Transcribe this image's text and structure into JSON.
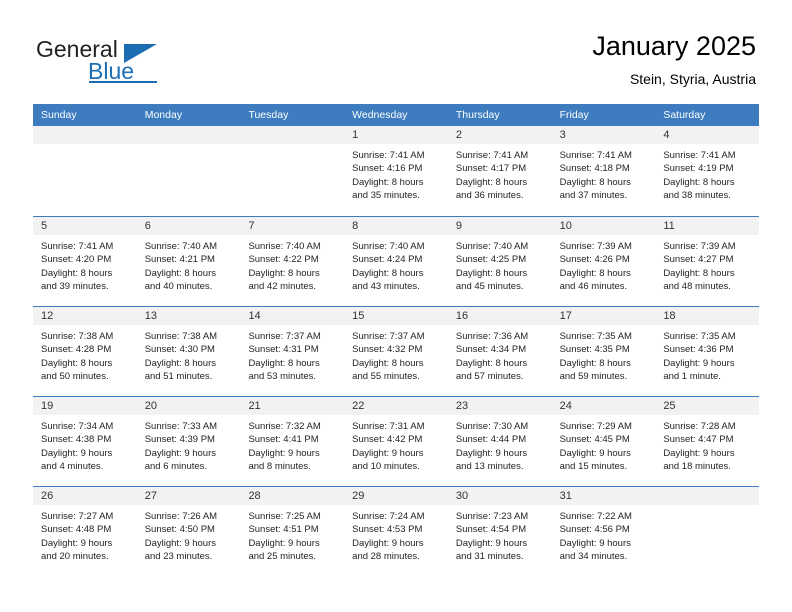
{
  "brand": {
    "name_part1": "General",
    "name_part2": "Blue",
    "logo_icon": "triangle-play-icon",
    "accent_color": "#1b6cb0"
  },
  "header": {
    "title": "January 2025",
    "subtitle": "Stein, Styria, Austria"
  },
  "calendar": {
    "header_bg": "#3d7cbf",
    "daynum_bg": "#f2f2f2",
    "weekdays": [
      "Sunday",
      "Monday",
      "Tuesday",
      "Wednesday",
      "Thursday",
      "Friday",
      "Saturday"
    ],
    "weeks": [
      [
        {
          "day": "",
          "lines": []
        },
        {
          "day": "",
          "lines": []
        },
        {
          "day": "",
          "lines": []
        },
        {
          "day": "1",
          "lines": [
            "Sunrise: 7:41 AM",
            "Sunset: 4:16 PM",
            "Daylight: 8 hours",
            "and 35 minutes."
          ]
        },
        {
          "day": "2",
          "lines": [
            "Sunrise: 7:41 AM",
            "Sunset: 4:17 PM",
            "Daylight: 8 hours",
            "and 36 minutes."
          ]
        },
        {
          "day": "3",
          "lines": [
            "Sunrise: 7:41 AM",
            "Sunset: 4:18 PM",
            "Daylight: 8 hours",
            "and 37 minutes."
          ]
        },
        {
          "day": "4",
          "lines": [
            "Sunrise: 7:41 AM",
            "Sunset: 4:19 PM",
            "Daylight: 8 hours",
            "and 38 minutes."
          ]
        }
      ],
      [
        {
          "day": "5",
          "lines": [
            "Sunrise: 7:41 AM",
            "Sunset: 4:20 PM",
            "Daylight: 8 hours",
            "and 39 minutes."
          ]
        },
        {
          "day": "6",
          "lines": [
            "Sunrise: 7:40 AM",
            "Sunset: 4:21 PM",
            "Daylight: 8 hours",
            "and 40 minutes."
          ]
        },
        {
          "day": "7",
          "lines": [
            "Sunrise: 7:40 AM",
            "Sunset: 4:22 PM",
            "Daylight: 8 hours",
            "and 42 minutes."
          ]
        },
        {
          "day": "8",
          "lines": [
            "Sunrise: 7:40 AM",
            "Sunset: 4:24 PM",
            "Daylight: 8 hours",
            "and 43 minutes."
          ]
        },
        {
          "day": "9",
          "lines": [
            "Sunrise: 7:40 AM",
            "Sunset: 4:25 PM",
            "Daylight: 8 hours",
            "and 45 minutes."
          ]
        },
        {
          "day": "10",
          "lines": [
            "Sunrise: 7:39 AM",
            "Sunset: 4:26 PM",
            "Daylight: 8 hours",
            "and 46 minutes."
          ]
        },
        {
          "day": "11",
          "lines": [
            "Sunrise: 7:39 AM",
            "Sunset: 4:27 PM",
            "Daylight: 8 hours",
            "and 48 minutes."
          ]
        }
      ],
      [
        {
          "day": "12",
          "lines": [
            "Sunrise: 7:38 AM",
            "Sunset: 4:28 PM",
            "Daylight: 8 hours",
            "and 50 minutes."
          ]
        },
        {
          "day": "13",
          "lines": [
            "Sunrise: 7:38 AM",
            "Sunset: 4:30 PM",
            "Daylight: 8 hours",
            "and 51 minutes."
          ]
        },
        {
          "day": "14",
          "lines": [
            "Sunrise: 7:37 AM",
            "Sunset: 4:31 PM",
            "Daylight: 8 hours",
            "and 53 minutes."
          ]
        },
        {
          "day": "15",
          "lines": [
            "Sunrise: 7:37 AM",
            "Sunset: 4:32 PM",
            "Daylight: 8 hours",
            "and 55 minutes."
          ]
        },
        {
          "day": "16",
          "lines": [
            "Sunrise: 7:36 AM",
            "Sunset: 4:34 PM",
            "Daylight: 8 hours",
            "and 57 minutes."
          ]
        },
        {
          "day": "17",
          "lines": [
            "Sunrise: 7:35 AM",
            "Sunset: 4:35 PM",
            "Daylight: 8 hours",
            "and 59 minutes."
          ]
        },
        {
          "day": "18",
          "lines": [
            "Sunrise: 7:35 AM",
            "Sunset: 4:36 PM",
            "Daylight: 9 hours",
            "and 1 minute."
          ]
        }
      ],
      [
        {
          "day": "19",
          "lines": [
            "Sunrise: 7:34 AM",
            "Sunset: 4:38 PM",
            "Daylight: 9 hours",
            "and 4 minutes."
          ]
        },
        {
          "day": "20",
          "lines": [
            "Sunrise: 7:33 AM",
            "Sunset: 4:39 PM",
            "Daylight: 9 hours",
            "and 6 minutes."
          ]
        },
        {
          "day": "21",
          "lines": [
            "Sunrise: 7:32 AM",
            "Sunset: 4:41 PM",
            "Daylight: 9 hours",
            "and 8 minutes."
          ]
        },
        {
          "day": "22",
          "lines": [
            "Sunrise: 7:31 AM",
            "Sunset: 4:42 PM",
            "Daylight: 9 hours",
            "and 10 minutes."
          ]
        },
        {
          "day": "23",
          "lines": [
            "Sunrise: 7:30 AM",
            "Sunset: 4:44 PM",
            "Daylight: 9 hours",
            "and 13 minutes."
          ]
        },
        {
          "day": "24",
          "lines": [
            "Sunrise: 7:29 AM",
            "Sunset: 4:45 PM",
            "Daylight: 9 hours",
            "and 15 minutes."
          ]
        },
        {
          "day": "25",
          "lines": [
            "Sunrise: 7:28 AM",
            "Sunset: 4:47 PM",
            "Daylight: 9 hours",
            "and 18 minutes."
          ]
        }
      ],
      [
        {
          "day": "26",
          "lines": [
            "Sunrise: 7:27 AM",
            "Sunset: 4:48 PM",
            "Daylight: 9 hours",
            "and 20 minutes."
          ]
        },
        {
          "day": "27",
          "lines": [
            "Sunrise: 7:26 AM",
            "Sunset: 4:50 PM",
            "Daylight: 9 hours",
            "and 23 minutes."
          ]
        },
        {
          "day": "28",
          "lines": [
            "Sunrise: 7:25 AM",
            "Sunset: 4:51 PM",
            "Daylight: 9 hours",
            "and 25 minutes."
          ]
        },
        {
          "day": "29",
          "lines": [
            "Sunrise: 7:24 AM",
            "Sunset: 4:53 PM",
            "Daylight: 9 hours",
            "and 28 minutes."
          ]
        },
        {
          "day": "30",
          "lines": [
            "Sunrise: 7:23 AM",
            "Sunset: 4:54 PM",
            "Daylight: 9 hours",
            "and 31 minutes."
          ]
        },
        {
          "day": "31",
          "lines": [
            "Sunrise: 7:22 AM",
            "Sunset: 4:56 PM",
            "Daylight: 9 hours",
            "and 34 minutes."
          ]
        },
        {
          "day": "",
          "lines": []
        }
      ]
    ]
  }
}
